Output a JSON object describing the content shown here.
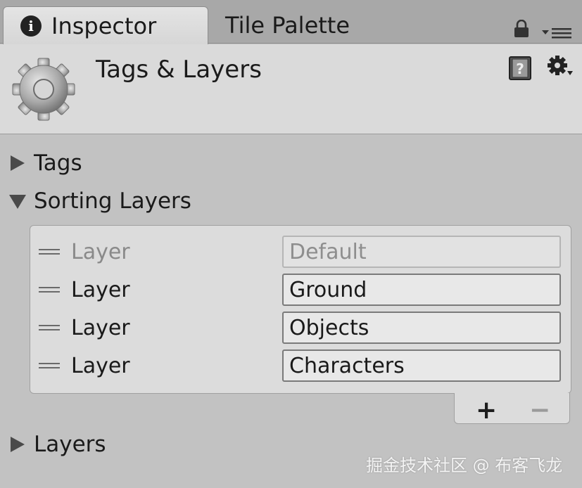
{
  "tabs": {
    "inspector": "Inspector",
    "tile_palette": "Tile Palette"
  },
  "header": {
    "title": "Tags & Layers"
  },
  "sections": {
    "tags": "Tags",
    "sorting_layers": "Sorting Layers",
    "layers": "Layers"
  },
  "sorting_layers": [
    {
      "label": "Layer",
      "value": "Default",
      "disabled": true
    },
    {
      "label": "Layer",
      "value": "Ground",
      "disabled": false
    },
    {
      "label": "Layer",
      "value": "Objects",
      "disabled": false
    },
    {
      "label": "Layer",
      "value": "Characters",
      "disabled": false
    }
  ],
  "buttons": {
    "add": "+",
    "remove": "−"
  },
  "icons": {
    "info": "info-icon",
    "lock": "lock-icon",
    "menu": "tab-menu-icon",
    "gear": "gear-icon",
    "help": "help-book-icon",
    "settings": "settings-gear-icon"
  },
  "watermark": "掘金技术社区 @ 布客飞龙"
}
